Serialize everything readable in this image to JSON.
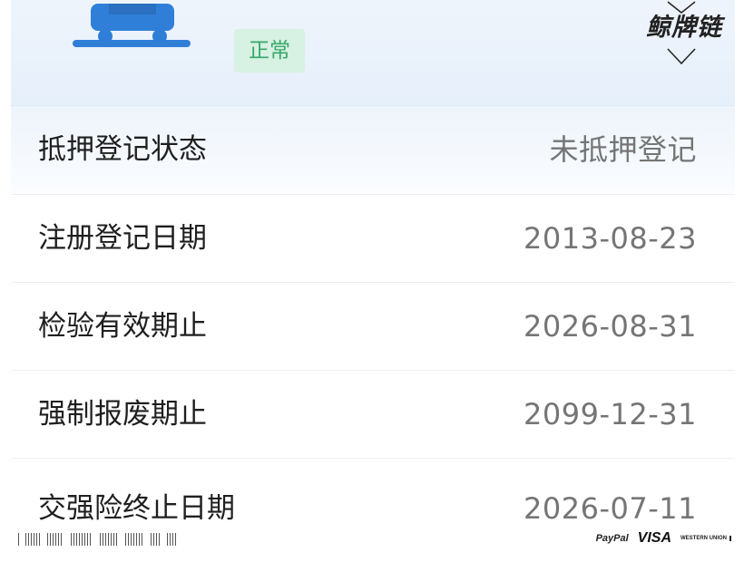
{
  "header": {
    "status_badge": "正常",
    "watermark": "鲸牌链"
  },
  "rows": [
    {
      "label": "抵押登记状态",
      "value": "未抵押登记"
    },
    {
      "label": "注册登记日期",
      "value": "2013-08-23"
    },
    {
      "label": "检验有效期止",
      "value": "2026-08-31"
    },
    {
      "label": "强制报废期止",
      "value": "2099-12-31"
    },
    {
      "label": "交强险终止日期",
      "value": "2026-07-11"
    }
  ],
  "footer": {
    "brands": [
      "PayPal",
      "VISA",
      "WESTERN UNION"
    ]
  },
  "colors": {
    "status_badge_bg": "#d7f1e2",
    "status_badge_text": "#37a76a",
    "car_icon": "#2f7fd8",
    "value_text": "#757575"
  }
}
